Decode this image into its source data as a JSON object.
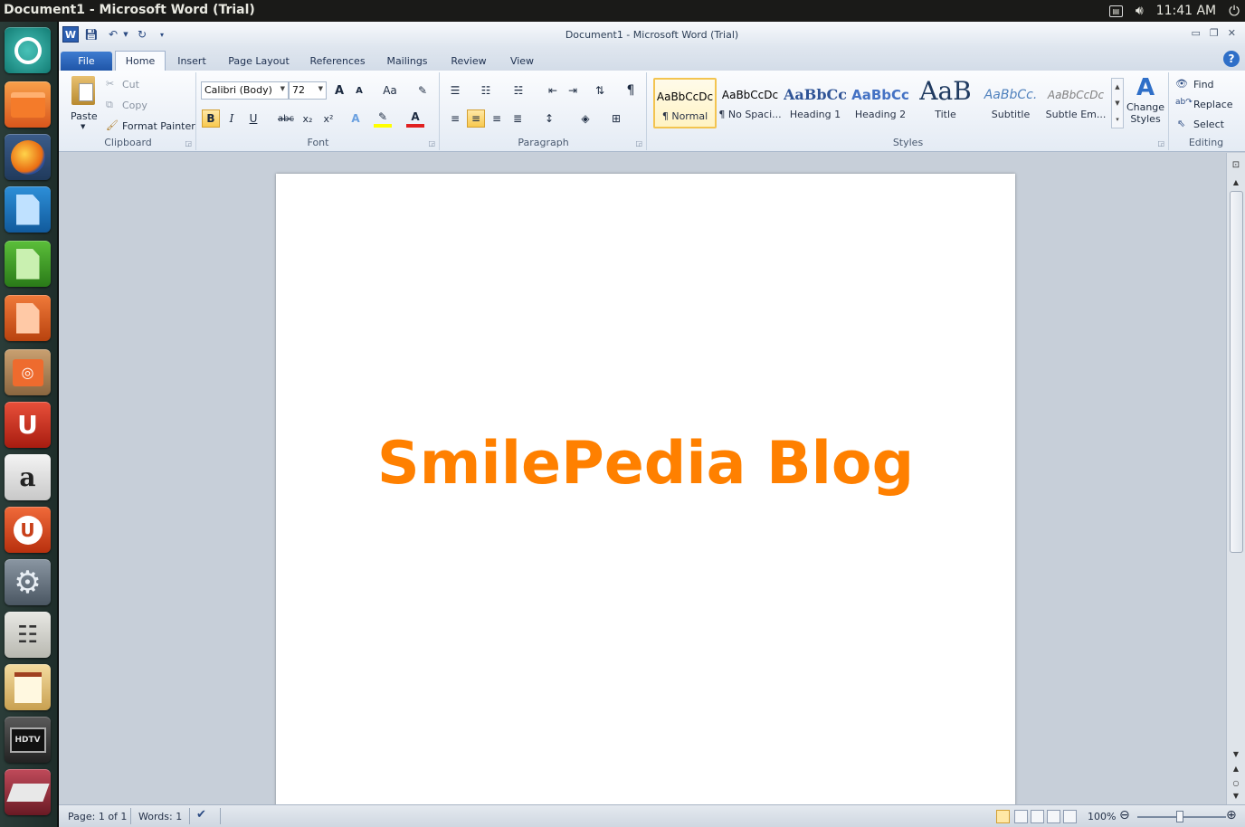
{
  "system": {
    "window_title": "Document1 - Microsoft Word (Trial)",
    "clock": "11:41 AM"
  },
  "window": {
    "title": "Document1  -  Microsoft Word (Trial)"
  },
  "tabs": {
    "file": "File",
    "home": "Home",
    "insert": "Insert",
    "page_layout": "Page Layout",
    "references": "References",
    "mailings": "Mailings",
    "review": "Review",
    "view": "View"
  },
  "clipboard": {
    "group_label": "Clipboard",
    "paste": "Paste",
    "cut": "Cut",
    "copy": "Copy",
    "format_painter": "Format Painter"
  },
  "font": {
    "group_label": "Font",
    "font_name": "Calibri (Body)",
    "font_size": "72",
    "bold": "B",
    "italic": "I",
    "underline": "U",
    "strike": "abc",
    "subscript": "x₂",
    "superscript": "x²",
    "change_case": "Aa",
    "grow": "A",
    "shrink": "A"
  },
  "paragraph": {
    "group_label": "Paragraph",
    "pilcrow": "¶"
  },
  "styles": {
    "group_label": "Styles",
    "items": [
      {
        "preview": "AaBbCcDc",
        "name": "¶ Normal"
      },
      {
        "preview": "AaBbCcDc",
        "name": "¶ No Spaci..."
      },
      {
        "preview": "AaBbCc",
        "name": "Heading 1"
      },
      {
        "preview": "AaBbCc",
        "name": "Heading 2"
      },
      {
        "preview": "AaB",
        "name": "Title"
      },
      {
        "preview": "AaBbCc.",
        "name": "Subtitle"
      },
      {
        "preview": "AaBbCcDc",
        "name": "Subtle Em..."
      }
    ],
    "change_styles_line1": "Change",
    "change_styles_line2": "Styles"
  },
  "editing": {
    "group_label": "Editing",
    "find": "Find",
    "replace": "Replace",
    "select": "Select"
  },
  "document": {
    "text": "SmilePedia Blog",
    "text_color": "#ff8000"
  },
  "status": {
    "page": "Page: 1 of 1",
    "words": "Words: 1",
    "zoom": "100%"
  }
}
